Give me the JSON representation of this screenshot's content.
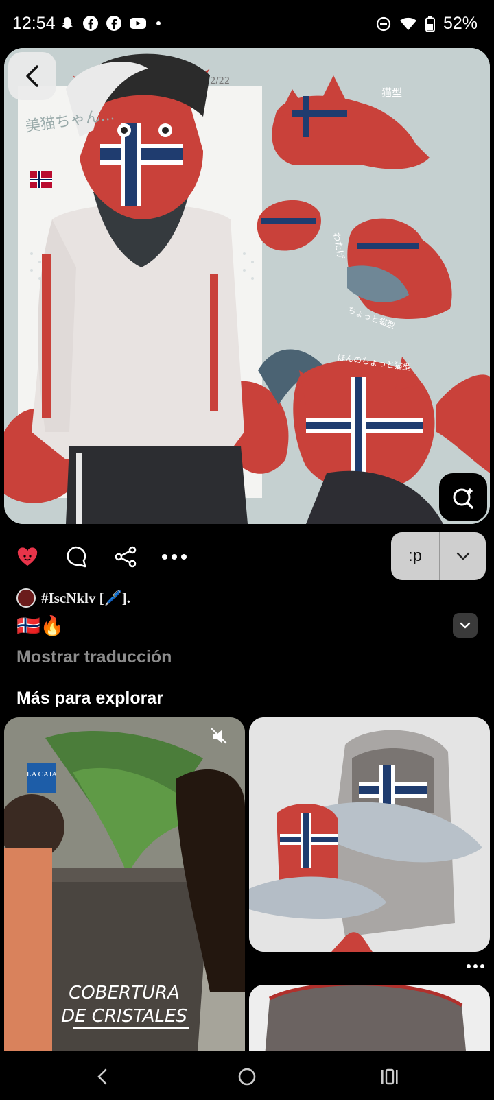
{
  "status_bar": {
    "time": "12:54",
    "battery": "52%",
    "left_icons": [
      "snapchat-icon",
      "facebook-icon",
      "facebook-icon",
      "youtube-icon",
      "dot-icon"
    ],
    "right_icons": [
      "do-not-disturb-icon",
      "wifi-icon",
      "battery-icon"
    ]
  },
  "pin": {
    "image_texts": {
      "date": "2/22",
      "side_note": "美猫ちゃん...",
      "cat_type": "猫型",
      "watashi": "わたげ",
      "note_chotto": "ちょっと猫型",
      "note_honno": "ほんのちょっと猫型"
    }
  },
  "actions": {
    "icons": [
      "heart-icon",
      "comment-icon",
      "share-icon",
      "more-icon"
    ],
    "board_name": ":p"
  },
  "description": {
    "author": "#IscNklv [🖊️].",
    "emojis": "🇳🇴🔥",
    "translate_link": "Mostrar traducción"
  },
  "explore": {
    "title": "Más para explorar",
    "left_card": {
      "brand": "LA CAJA",
      "caption_line1": "COBERTURA",
      "caption_line2": "DE CRISTALES"
    }
  },
  "colors": {
    "background": "#000000",
    "like_red": "#e8344a",
    "muted_text": "#8c8c8c",
    "norway_red": "#ba0c2f",
    "norway_blue": "#00205b"
  }
}
